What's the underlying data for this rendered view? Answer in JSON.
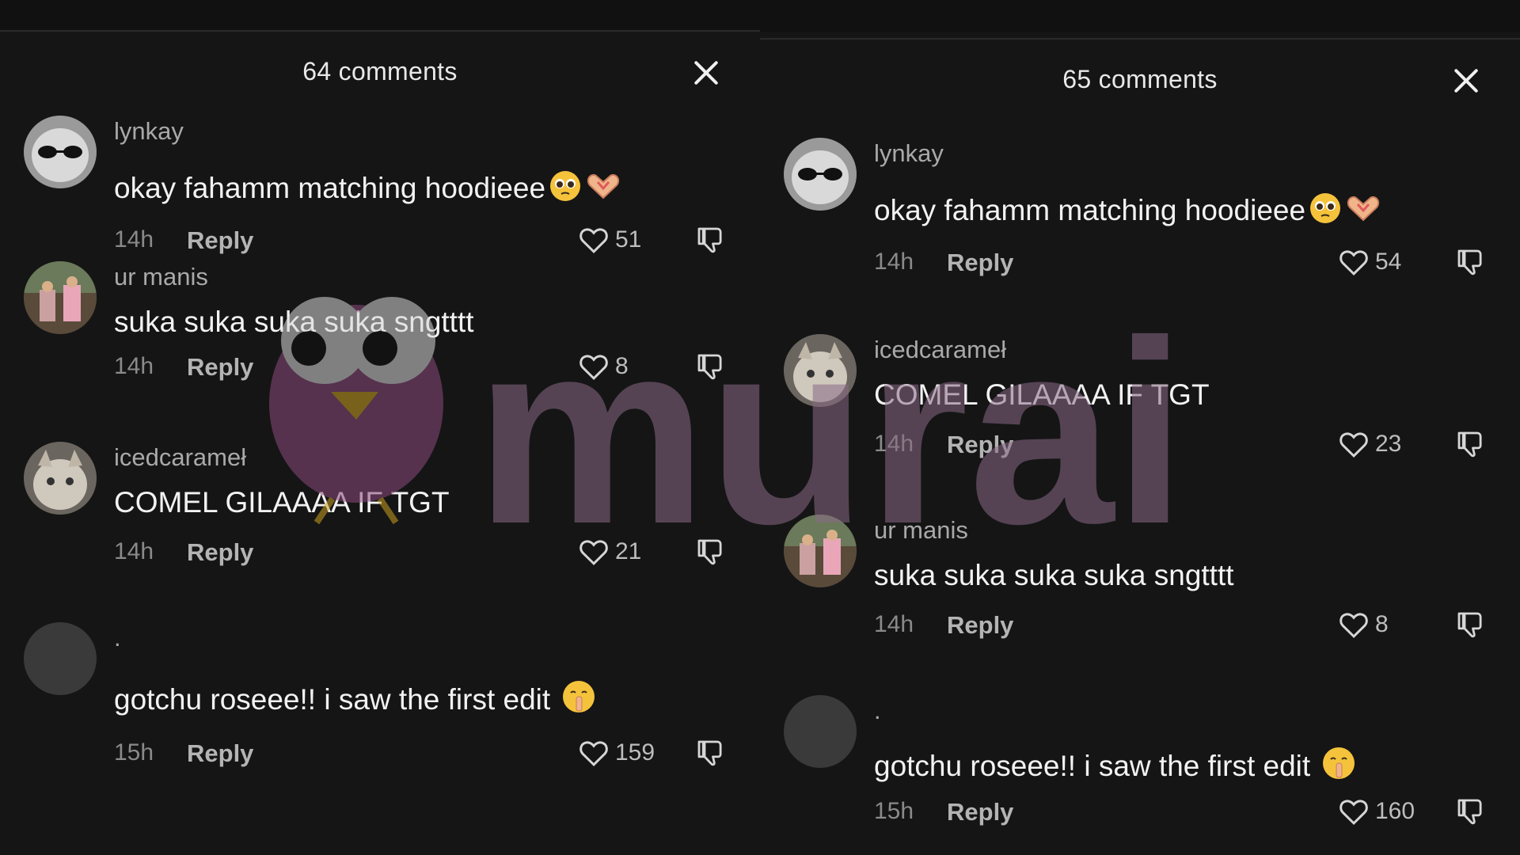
{
  "panels": [
    {
      "title": "64 comments",
      "comments": [
        {
          "username": "lynkay",
          "text": "okay fahamm matching hoodieee",
          "time": "14h",
          "reply": "Reply",
          "likes": "51",
          "emojis": [
            "pleading-face",
            "heart-hands"
          ]
        },
        {
          "username": "ur manis",
          "text": "suka suka suka suka sngtttt",
          "time": "14h",
          "reply": "Reply",
          "likes": "8",
          "emojis": []
        },
        {
          "username": "icedcarameł",
          "text": "COMEL GILAAAA IF TGT",
          "time": "14h",
          "reply": "Reply",
          "likes": "21",
          "emojis": []
        },
        {
          "username": ".",
          "text": "gotchu roseee!! i saw the first edit",
          "time": "15h",
          "reply": "Reply",
          "likes": "159",
          "emojis": [
            "shushing-face"
          ]
        }
      ]
    },
    {
      "title": "65 comments",
      "comments": [
        {
          "username": "lynkay",
          "text": "okay fahamm matching hoodieee",
          "time": "14h",
          "reply": "Reply",
          "likes": "54",
          "emojis": [
            "pleading-face",
            "heart-hands"
          ]
        },
        {
          "username": "icedcarameł",
          "text": "COMEL GILAAAA IF TGT",
          "time": "14h",
          "reply": "Reply",
          "likes": "23",
          "emojis": []
        },
        {
          "username": "ur manis",
          "text": "suka suka suka suka sngtttt",
          "time": "14h",
          "reply": "Reply",
          "likes": "8",
          "emojis": []
        },
        {
          "username": ".",
          "text": "gotchu roseee!! i saw the first edit",
          "time": "15h",
          "reply": "Reply",
          "likes": "160",
          "emojis": [
            "shushing-face"
          ]
        }
      ]
    }
  ],
  "watermark": {
    "text": "murai",
    "color": "#8a6a86"
  }
}
